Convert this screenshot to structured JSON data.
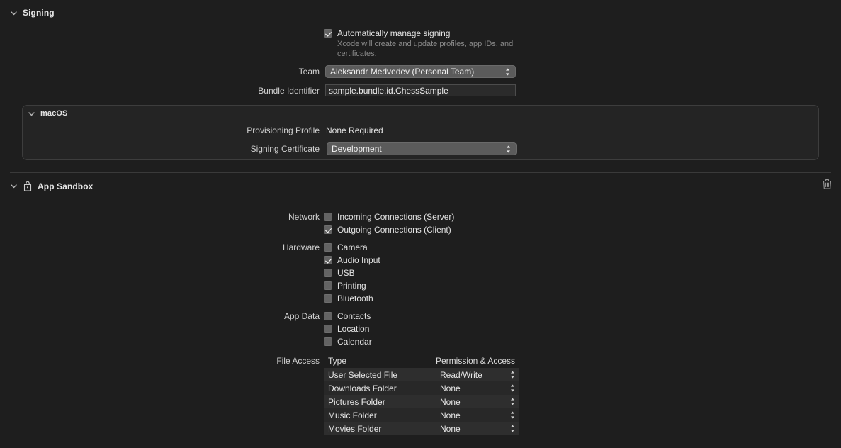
{
  "signing": {
    "header": "Signing",
    "auto_manage": {
      "label": "Automatically manage signing",
      "checked": true,
      "description": "Xcode will create and update profiles, app IDs, and certificates."
    },
    "team": {
      "label": "Team",
      "value": "Aleksandr Medvedev (Personal Team)"
    },
    "bundle_identifier": {
      "label": "Bundle Identifier",
      "value": "sample.bundle.id.ChessSample"
    },
    "macos": {
      "header": "macOS",
      "provisioning_profile": {
        "label": "Provisioning Profile",
        "value": "None Required"
      },
      "signing_certificate": {
        "label": "Signing Certificate",
        "value": "Development"
      }
    }
  },
  "app_sandbox": {
    "header": "App Sandbox",
    "icon": "sandbox-icon",
    "delete_icon": "trash-icon",
    "groups": [
      {
        "label": "Network",
        "items": [
          {
            "label": "Incoming Connections (Server)",
            "checked": false
          },
          {
            "label": "Outgoing Connections (Client)",
            "checked": true
          }
        ]
      },
      {
        "label": "Hardware",
        "items": [
          {
            "label": "Camera",
            "checked": false
          },
          {
            "label": "Audio Input",
            "checked": true
          },
          {
            "label": "USB",
            "checked": false
          },
          {
            "label": "Printing",
            "checked": false
          },
          {
            "label": "Bluetooth",
            "checked": false
          }
        ]
      },
      {
        "label": "App Data",
        "items": [
          {
            "label": "Contacts",
            "checked": false
          },
          {
            "label": "Location",
            "checked": false
          },
          {
            "label": "Calendar",
            "checked": false
          }
        ]
      }
    ],
    "file_access": {
      "label": "File Access",
      "columns": [
        "Type",
        "Permission & Access"
      ],
      "rows": [
        {
          "type": "User Selected File",
          "permission": "Read/Write"
        },
        {
          "type": "Downloads Folder",
          "permission": "None"
        },
        {
          "type": "Pictures Folder",
          "permission": "None"
        },
        {
          "type": "Music Folder",
          "permission": "None"
        },
        {
          "type": "Movies Folder",
          "permission": "None"
        }
      ]
    }
  },
  "colors": {
    "background": "#1e1e1e",
    "panel": "#242424",
    "popup": "#5b5b5b",
    "text": "#e2e2e2",
    "muted": "#8b8b8b",
    "divider": "#3a3a3a"
  }
}
